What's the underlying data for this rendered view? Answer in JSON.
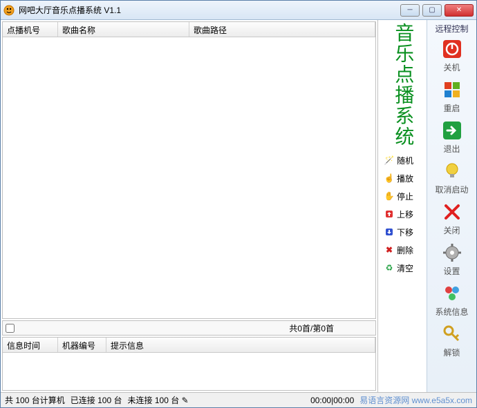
{
  "window": {
    "title": "网吧大厅音乐点播系统 V1.1"
  },
  "columns": {
    "playlist": {
      "c1": "点播机号",
      "c2": "歌曲名称",
      "c3": "歌曲路径"
    },
    "messages": {
      "c1": "信息时间",
      "c2": "机器编号",
      "c3": "提示信息"
    }
  },
  "midbar": {
    "count": "共0首/第0首"
  },
  "banner": "音乐点播系统",
  "side_buttons": {
    "random": "随机",
    "play": "播放",
    "stop": "停止",
    "up": "上移",
    "down": "下移",
    "delete": "删除",
    "clear": "清空"
  },
  "right": {
    "header": "远程控制",
    "shutdown": "关机",
    "restart": "重启",
    "exit": "退出",
    "cancel_start": "取消启动",
    "close": "关闭",
    "settings": "设置",
    "sysinfo": "系统信息",
    "unlock": "解锁"
  },
  "status": {
    "total_prefix": "共",
    "total_count": "100",
    "total_suffix": "台计算机",
    "connected_prefix": "已连接",
    "connected_count": "100",
    "connected_suffix": "台",
    "disconnected_prefix": "未连接",
    "disconnected_count": "100",
    "disconnected_suffix": "台",
    "time": "00:00|00:00",
    "watermark": "易语言资源网",
    "watermark_url": "www.e5a5x.com"
  }
}
